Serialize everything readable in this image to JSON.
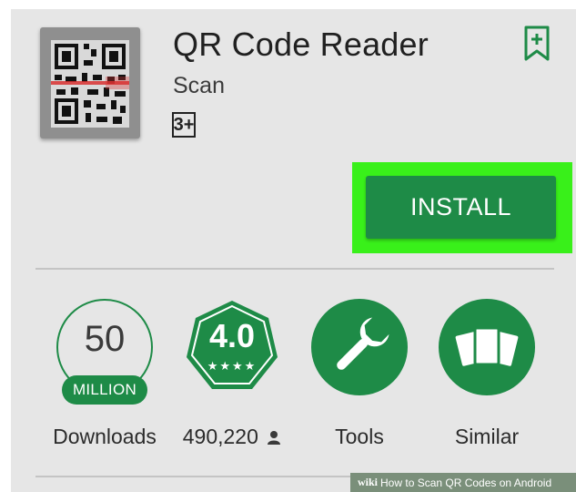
{
  "app": {
    "title": "QR Code Reader",
    "developer": "Scan",
    "content_rating": "3+",
    "install_label": "INSTALL"
  },
  "stats": [
    {
      "badge_value": "50",
      "badge_sub": "MILLION",
      "label": "Downloads"
    },
    {
      "badge_value": "4.0",
      "badge_sub": "★★★★",
      "label": "490,220"
    },
    {
      "icon": "wrench-icon",
      "label": "Tools"
    },
    {
      "icon": "cards-icon",
      "label": "Similar"
    }
  ],
  "watermark": {
    "brand": "wiki",
    "text": "How to Scan QR Codes on Android"
  },
  "colors": {
    "accent": "#1e8b47",
    "highlight": "#39f01a",
    "background": "#e6e6e6"
  }
}
